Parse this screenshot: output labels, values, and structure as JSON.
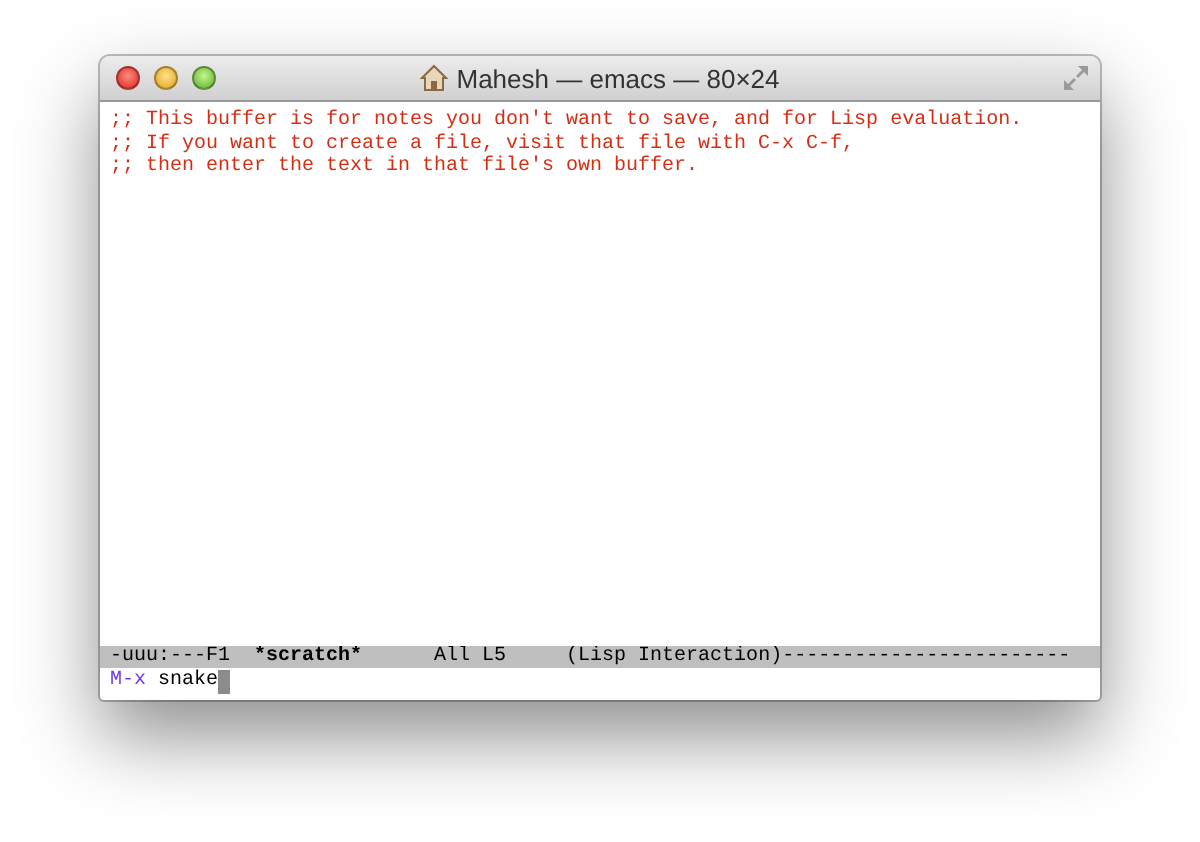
{
  "window": {
    "title": "Mahesh — emacs — 80×24"
  },
  "buffer": {
    "lines": [
      ";; This buffer is for notes you don't want to save, and for Lisp evaluation.",
      ";; If you want to create a file, visit that file with C-x C-f,",
      ";; then enter the text in that file's own buffer."
    ]
  },
  "mode_line": [
    {
      "text": "-uuu:---F1",
      "bold": false
    },
    {
      "text": "*scratch*",
      "bold": true
    },
    {
      "text": "All L5",
      "bold": false
    },
    {
      "text": "(Lisp Interaction)",
      "bold": false
    },
    {
      "text": "------------------------",
      "bold": false
    }
  ],
  "minibuffer": {
    "prompt": "M-x",
    "value": "snake"
  }
}
